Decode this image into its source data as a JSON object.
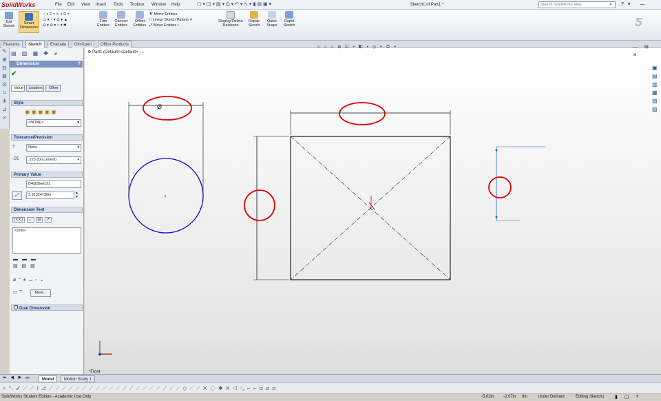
{
  "app": {
    "logo": "SolidWorks",
    "window_title": "Sketch1 of Part1 *"
  },
  "menus": [
    "File",
    "Edit",
    "View",
    "Insert",
    "Tools",
    "Toolbox",
    "Window",
    "Help"
  ],
  "search": {
    "placeholder": "Search SolidWorks Help"
  },
  "ribbon": {
    "exit_sketch": "Exit Sketch",
    "smart_dimension": "Smart Dimension",
    "trim_entities": "Trim Entities",
    "convert_entities": "Convert Entities",
    "offset_entities": "Offset Entities",
    "mirror_entities": "Mirror Entities",
    "linear_sketch_pattern": "Linear Sketch Pattern",
    "move_entities": "Move Entities",
    "display_delete_relations": "Display/Delete Relations",
    "repair_sketch": "Repair Sketch",
    "quick_snaps": "Quick Snaps",
    "rapid_sketch": "Rapid Sketch"
  },
  "command_tabs": [
    "Features",
    "Sketch",
    "Evaluate",
    "DimXpert",
    "Office Products"
  ],
  "tree": {
    "root": "Part1 (Default<<Default>_..."
  },
  "panel": {
    "title": "Dimension",
    "tabs": [
      "Value",
      "Leaders",
      "Other"
    ],
    "style": {
      "label": "Style",
      "value": "<NONE>"
    },
    "tolerance": {
      "label": "Tolerance/Precision",
      "tolerance_value": "None",
      "precision_value": ".123 (Document)"
    },
    "primary": {
      "label": "Primary Value",
      "name": "D4@Sketch1",
      "value": "3.91324736in"
    },
    "dim_text": {
      "label": "Dimension Text",
      "text": "<DIM>",
      "more": "More..."
    },
    "dual": {
      "label": "Dual Dimension"
    }
  },
  "canvas": {
    "diameter_symbol": "Ø",
    "view_label": "*Front"
  },
  "bottom_tabs": [
    "Model",
    "Motion Study 1"
  ],
  "status": {
    "edition": "SolidWorks Student Edition - Academic Use Only",
    "x": "-5.02in",
    "y": "-2.07in",
    "z": "0in",
    "state": "Under Defined",
    "editing": "Editing Sketch1"
  }
}
